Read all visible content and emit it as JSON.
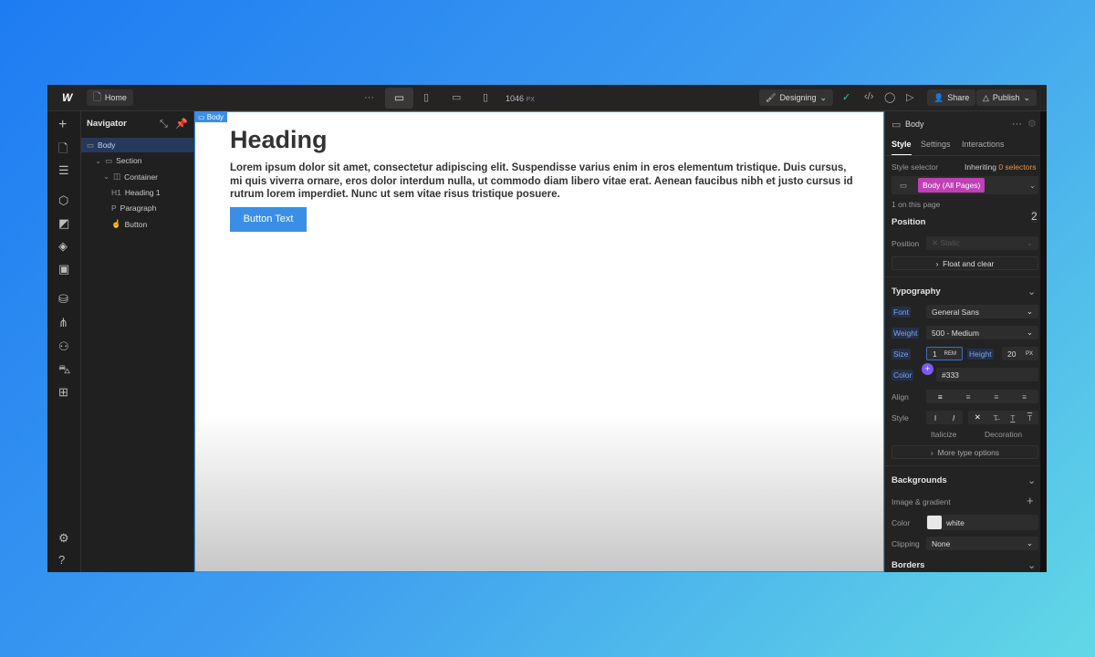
{
  "topbar": {
    "page": "Home",
    "more": "···",
    "width_value": "1046",
    "width_unit": "PX",
    "mode": "Designing",
    "share": "Share",
    "publish": "Publish"
  },
  "navigator": {
    "title": "Navigator",
    "items": [
      {
        "label": "Body",
        "icon": "body-icon",
        "prefix": "",
        "depth": 0,
        "selected": true
      },
      {
        "label": "Section",
        "icon": "section-icon",
        "prefix": "",
        "depth": 1
      },
      {
        "label": "Container",
        "icon": "container-icon",
        "prefix": "",
        "depth": 2
      },
      {
        "label": "Heading 1",
        "icon": "heading-icon",
        "prefix": "H1",
        "depth": 3
      },
      {
        "label": "Paragraph",
        "icon": "paragraph-icon",
        "prefix": "P",
        "depth": 3
      },
      {
        "label": "Button",
        "icon": "button-icon",
        "prefix": "",
        "depth": 3
      }
    ]
  },
  "canvas": {
    "tag": "Body",
    "heading": "Heading",
    "paragraph": "Lorem ipsum dolor sit amet, consectetur adipiscing elit. Suspendisse varius enim in eros elementum tristique. Duis cursus, mi quis viverra ornare, eros dolor interdum nulla, ut commodo diam libero vitae erat. Aenean faucibus nibh et justo cursus id rutrum lorem imperdiet. Nunc ut sem vitae risus tristique posuere.",
    "button": "Button Text",
    "button_color": "#3a8ee6"
  },
  "panel": {
    "element": "Body",
    "tabs": [
      "Style",
      "Settings",
      "Interactions"
    ],
    "style_selector": "Style selector",
    "inheriting": "Inheriting",
    "selectors": "0 selectors",
    "selector_chip": "Body (All Pages)",
    "chip_color": "#c13fb7",
    "on_page": "1 on this page",
    "badge": "2",
    "position": {
      "title": "Position",
      "label": "Position",
      "value": "Static",
      "float": "Float and clear"
    },
    "typography": {
      "title": "Typography",
      "font_label": "Font",
      "font": "General Sans",
      "weight_label": "Weight",
      "weight": "500 - Medium",
      "size_label": "Size",
      "size": "1",
      "size_unit": "REM",
      "height_label": "Height",
      "height": "20",
      "height_unit": "PX",
      "color_label": "Color",
      "color": "#333",
      "align_label": "Align",
      "style_label": "Style",
      "italicize": "Italicize",
      "decoration": "Decoration",
      "more": "More type options"
    },
    "backgrounds": {
      "title": "Backgrounds",
      "image": "Image & gradient",
      "color_label": "Color",
      "color": "white",
      "clipping_label": "Clipping",
      "clipping": "None"
    },
    "borders": {
      "title": "Borders"
    }
  }
}
